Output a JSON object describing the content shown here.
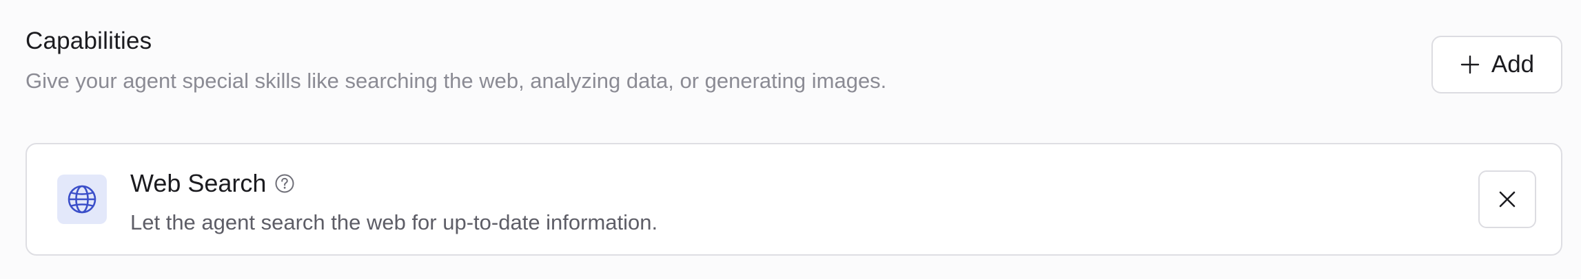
{
  "capabilities": {
    "title": "Capabilities",
    "description": "Give your agent special skills like searching the web, analyzing data, or generating images.",
    "add_button": {
      "label": "Add",
      "icon": "plus-icon"
    },
    "items": [
      {
        "title": "Web Search",
        "description": "Let the agent search the web for up-to-date information.",
        "icon": "globe-icon",
        "help_icon": "help-circle-icon",
        "remove_icon": "close-icon"
      }
    ]
  },
  "colors": {
    "background": "#fbfbfc",
    "text_primary": "#1b1b1f",
    "text_muted": "#8b8b94",
    "text_secondary": "#5d5d66",
    "border": "#dedee3",
    "icon_tile_bg": "#e3e8fa",
    "icon_accent": "#3b4fc9"
  }
}
